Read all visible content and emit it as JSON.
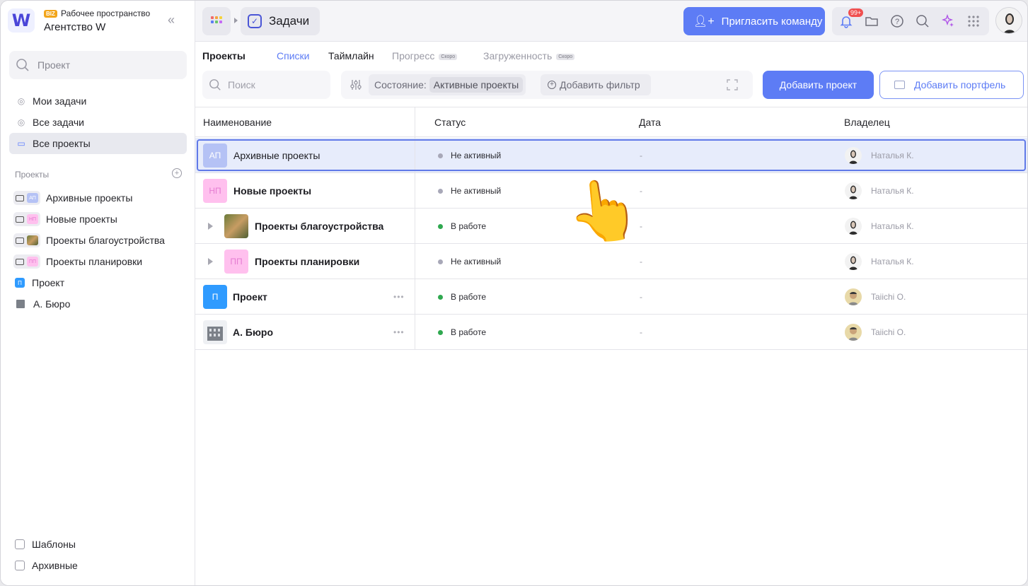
{
  "workspace": {
    "badge": "BIZ",
    "subtitle": "Рабочее пространство",
    "name": "Агентство W",
    "logo_letter": "W"
  },
  "sidebar": {
    "search_placeholder": "Проект",
    "nav": [
      {
        "label": "Мои задачи",
        "active": false
      },
      {
        "label": "Все задачи",
        "active": false
      },
      {
        "label": "Все проекты",
        "active": true
      }
    ],
    "projects_heading": "Проекты",
    "projects": [
      {
        "label": "Архивные проекты",
        "abbr": "АП"
      },
      {
        "label": "Новые проекты",
        "abbr": "НП"
      },
      {
        "label": "Проекты благоустройства",
        "abbr": ""
      },
      {
        "label": "Проекты планировки",
        "abbr": "ПП"
      },
      {
        "label": "Проект",
        "abbr": "П"
      },
      {
        "label": "А. Бюро",
        "abbr": ""
      }
    ],
    "bottom": [
      {
        "label": "Шаблоны"
      },
      {
        "label": "Архивные"
      }
    ]
  },
  "topbar": {
    "current_module": "Задачи",
    "invite_label": "Пригласить команду",
    "notif_badge": "99+",
    "icons": [
      "bell-icon",
      "folder-icon",
      "help-icon",
      "search-icon",
      "sparkles-icon",
      "grid-icon"
    ]
  },
  "tabs": {
    "heading": "Проекты",
    "items": [
      {
        "label": "Списки",
        "active": true,
        "soon": ""
      },
      {
        "label": "Таймлайн",
        "active": false,
        "soon": ""
      },
      {
        "label": "Прогресс",
        "active": false,
        "soon": "Скоро"
      },
      {
        "label": "Загруженность",
        "active": false,
        "soon": "Скоро"
      }
    ]
  },
  "filters": {
    "search_placeholder": "Поиск",
    "state_label": "Состояние:",
    "state_value": "Активные проекты",
    "add_filter": "Добавить фильтр",
    "add_project": "Добавить проект",
    "add_portfolio": "Добавить портфель"
  },
  "table": {
    "columns": [
      "Наименование",
      "Статус",
      "Дата",
      "Владелец"
    ],
    "rows": [
      {
        "abbr": "АП",
        "name": "Архивные проекты",
        "status": "Не активный",
        "date": "-",
        "owner": "Наталья К."
      },
      {
        "abbr": "НП",
        "name": "Новые проекты",
        "status": "Не активный",
        "date": "-",
        "owner": "Наталья К."
      },
      {
        "abbr": "",
        "name": "Проекты благоустройства",
        "status": "В работе",
        "date": "-",
        "owner": "Наталья К."
      },
      {
        "abbr": "ПП",
        "name": "Проекты планировки",
        "status": "Не активный",
        "date": "-",
        "owner": "Наталья К."
      },
      {
        "abbr": "П",
        "name": "Проект",
        "status": "В работе",
        "date": "-",
        "owner": "Taiichi O."
      },
      {
        "abbr": "",
        "name": "А. Бюро",
        "status": "В работе",
        "date": "-",
        "owner": "Taiichi O."
      }
    ]
  },
  "colors": {
    "accent": "#5d7cf5",
    "active_status": "#2fa84f",
    "inactive_status": "#a8a8b8",
    "selected_row": "#e7ecfb"
  }
}
